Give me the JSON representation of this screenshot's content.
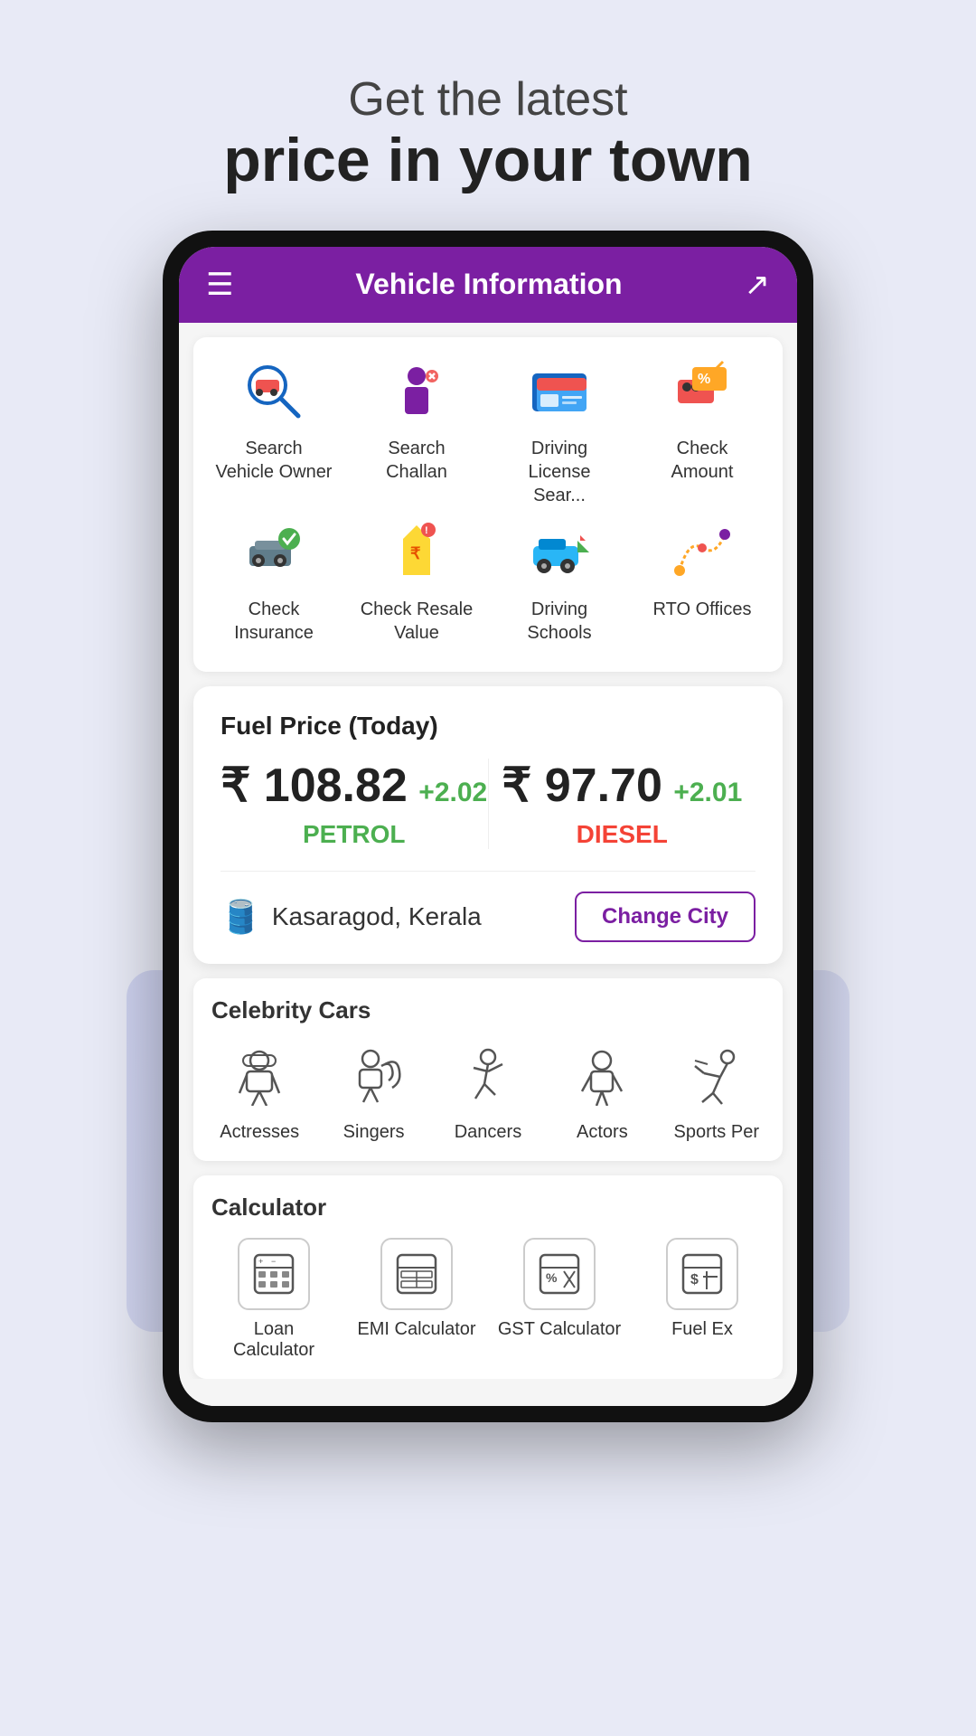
{
  "header": {
    "subtitle": "Get the latest",
    "title": "price in your town"
  },
  "appBar": {
    "title": "Vehicle Information",
    "hamburgerIcon": "☰",
    "shareIcon": "⎙"
  },
  "vehicleGrid": {
    "row1": [
      {
        "label": "Search Vehicle Owner",
        "icon": "🔍🚗",
        "iconEmoji": "🔍"
      },
      {
        "label": "Search Challan",
        "icon": "👮"
      },
      {
        "label": "Driving License Sear...",
        "icon": "🪪"
      },
      {
        "label": "Check Amount",
        "icon": "🚗💰"
      }
    ],
    "row2": [
      {
        "label": "Check Insurance",
        "icon": "🚗✅"
      },
      {
        "label": "Check Resale Value",
        "icon": "🏷️"
      },
      {
        "label": "Driving Schools",
        "icon": "🚙"
      },
      {
        "label": "RTO Offices",
        "icon": "🗺️"
      }
    ]
  },
  "fuelCard": {
    "title": "Fuel Price (Today)",
    "petrol": {
      "price": "₹ 108.82",
      "change": "+2.02",
      "label": "PETROL"
    },
    "diesel": {
      "price": "₹ 97.70",
      "change": "+2.01",
      "label": "DIESEL"
    },
    "location": "Kasaragod, Kerala",
    "changeCityBtn": "Change City"
  },
  "celebrityCars": {
    "title": "Celebrity Cars",
    "items": [
      {
        "label": "Actresses",
        "icon": "🎭"
      },
      {
        "label": "Singers",
        "icon": "🎸"
      },
      {
        "label": "Dancers",
        "icon": "💃"
      },
      {
        "label": "Actors",
        "icon": "🎬"
      },
      {
        "label": "Sports Per",
        "icon": "⛷️"
      }
    ]
  },
  "calculator": {
    "title": "Calculator",
    "items": [
      {
        "label": "Loan Calculator",
        "icon": "🧮"
      },
      {
        "label": "EMI Calculator",
        "icon": "📊"
      },
      {
        "label": "GST Calculator",
        "icon": "🔢"
      },
      {
        "label": "Fuel Ex",
        "icon": "💲"
      }
    ]
  }
}
